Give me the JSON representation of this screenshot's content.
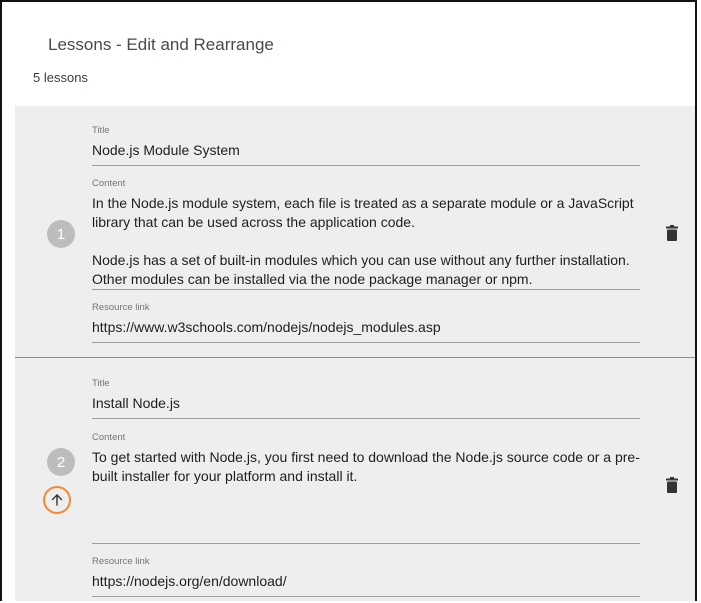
{
  "header": {
    "title": "Lessons - Edit and Rearrange",
    "count_text": "5 lessons"
  },
  "labels": {
    "title": "Title",
    "content": "Content",
    "resource": "Resource link"
  },
  "lessons": [
    {
      "number": "1",
      "title": "Node.js Module System",
      "content": "In the Node.js module system, each file is treated as a separate module or a JavaScript library that can be used across the application code.\n\nNode.js has a set of built-in modules which you can use without any further installation. Other modules can be installed via the node package manager or npm.",
      "resource": "https://www.w3schools.com/nodejs/nodejs_modules.asp",
      "has_move_up": false
    },
    {
      "number": "2",
      "title": "Install Node.js",
      "content": "To get started with Node.js, you first need to download the Node.js source code or a pre-built installer for your platform and install it.",
      "resource": "https://nodejs.org/en/download/",
      "has_move_up": true
    }
  ],
  "icons": {
    "delete": "trash-icon",
    "move_up": "arrow-up-icon"
  },
  "colors": {
    "lesson_bg": "#eeeeee",
    "badge": "#bdbdbd",
    "accent": "#f08a34"
  }
}
